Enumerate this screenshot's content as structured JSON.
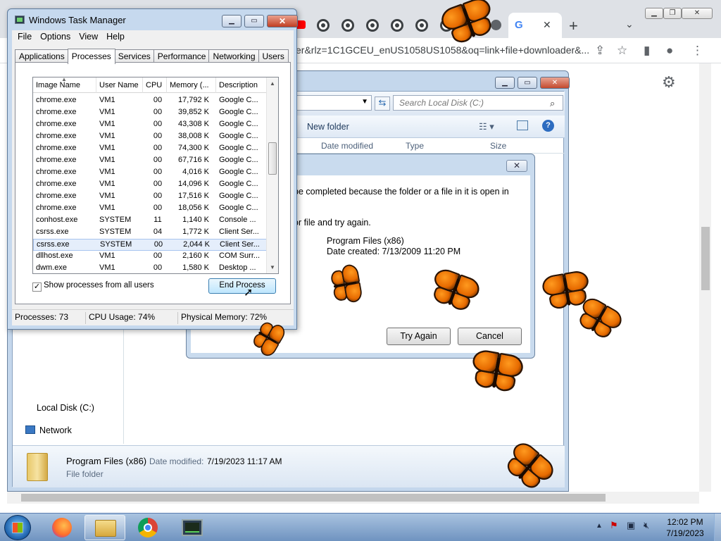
{
  "browser": {
    "url_text": "er&rlz=1C1GCEU_enUS1058US1058&oq=link+file+downloader&...",
    "tab_count_visible": 11,
    "new_tab_label": "+",
    "tab_close": "✕"
  },
  "explorer": {
    "search_placeholder": "Search Local Disk (C:)",
    "new_folder_label": "New folder",
    "columns": [
      "Date modified",
      "Type",
      "Size"
    ],
    "nav_items": [
      {
        "label": "Local Disk (C:)",
        "icon": "drive-icon"
      },
      {
        "label": "Network",
        "icon": "network-icon"
      }
    ],
    "details": {
      "name": "Program Files (x86)",
      "modified_label": "Date modified:",
      "modified_value": "7/19/2023 11:17 AM",
      "type": "File folder"
    }
  },
  "error_dialog": {
    "line1": "be completed because the folder or a file in it is open in",
    "line2": "or file and try again.",
    "item_name": "Program Files (x86)",
    "item_created": "Date created: 7/13/2009 11:20 PM",
    "try_again": "Try Again",
    "cancel": "Cancel"
  },
  "taskmgr": {
    "title": "Windows Task Manager",
    "menu": [
      "File",
      "Options",
      "View",
      "Help"
    ],
    "tabs": [
      "Applications",
      "Processes",
      "Services",
      "Performance",
      "Networking",
      "Users"
    ],
    "active_tab": "Processes",
    "columns": [
      "Image Name",
      "User Name",
      "CPU",
      "Memory (...",
      "Description"
    ],
    "rows": [
      {
        "image": "chrome.exe",
        "user": "VM1",
        "cpu": "00",
        "mem": "17,792 K",
        "desc": "Google C..."
      },
      {
        "image": "chrome.exe",
        "user": "VM1",
        "cpu": "00",
        "mem": "39,852 K",
        "desc": "Google C..."
      },
      {
        "image": "chrome.exe",
        "user": "VM1",
        "cpu": "00",
        "mem": "43,308 K",
        "desc": "Google C..."
      },
      {
        "image": "chrome.exe",
        "user": "VM1",
        "cpu": "00",
        "mem": "38,008 K",
        "desc": "Google C..."
      },
      {
        "image": "chrome.exe",
        "user": "VM1",
        "cpu": "00",
        "mem": "74,300 K",
        "desc": "Google C..."
      },
      {
        "image": "chrome.exe",
        "user": "VM1",
        "cpu": "00",
        "mem": "67,716 K",
        "desc": "Google C..."
      },
      {
        "image": "chrome.exe",
        "user": "VM1",
        "cpu": "00",
        "mem": "4,016 K",
        "desc": "Google C..."
      },
      {
        "image": "chrome.exe",
        "user": "VM1",
        "cpu": "00",
        "mem": "14,096 K",
        "desc": "Google C..."
      },
      {
        "image": "chrome.exe",
        "user": "VM1",
        "cpu": "00",
        "mem": "17,516 K",
        "desc": "Google C..."
      },
      {
        "image": "chrome.exe",
        "user": "VM1",
        "cpu": "00",
        "mem": "18,056 K",
        "desc": "Google C..."
      },
      {
        "image": "conhost.exe",
        "user": "SYSTEM",
        "cpu": "11",
        "mem": "1,140 K",
        "desc": "Console ..."
      },
      {
        "image": "csrss.exe",
        "user": "SYSTEM",
        "cpu": "04",
        "mem": "1,772 K",
        "desc": "Client Ser..."
      },
      {
        "image": "csrss.exe",
        "user": "SYSTEM",
        "cpu": "00",
        "mem": "2,044 K",
        "desc": "Client Ser..."
      },
      {
        "image": "dllhost.exe",
        "user": "VM1",
        "cpu": "00",
        "mem": "2,160 K",
        "desc": "COM Surr..."
      },
      {
        "image": "dwm.exe",
        "user": "VM1",
        "cpu": "00",
        "mem": "1,580 K",
        "desc": "Desktop ..."
      }
    ],
    "selected_row": 12,
    "show_all_label": "Show processes from all users",
    "show_all_checked": "✓",
    "end_process": "End Process",
    "status": {
      "processes": "Processes: 73",
      "cpu": "CPU Usage: 74%",
      "memory": "Physical Memory: 72%"
    }
  },
  "taskbar": {
    "items": [
      "start-orb",
      "firefox-icon",
      "explorer-icon",
      "chrome-icon",
      "taskmgr-icon"
    ],
    "active_item": "explorer-icon",
    "time": "12:02 PM",
    "date": "7/19/2023"
  },
  "colors": {
    "win7_frame": "#c6d9ee",
    "butterfly_orange": "#e66a00",
    "selection": "#e5eefb"
  }
}
